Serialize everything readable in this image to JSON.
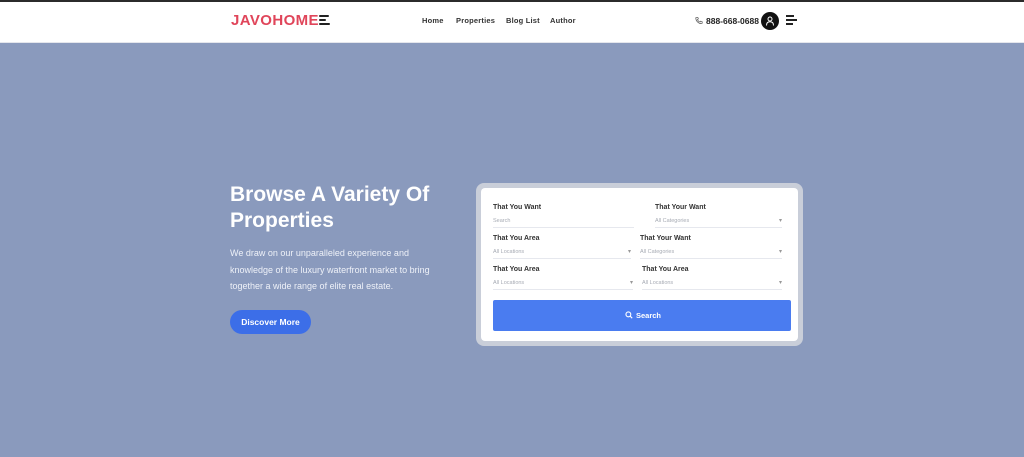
{
  "header": {
    "logo": "JAVOHOME",
    "nav": [
      "Home",
      "Properties",
      "Blog List",
      "Author"
    ],
    "phone": "888-668-0688"
  },
  "hero": {
    "title": "Browse A Variety Of Properties",
    "description": "We draw on our unparalleled experience and knowledge of the luxury waterfront market to bring together a wide range of elite real estate.",
    "cta": "Discover More"
  },
  "search_form": {
    "fields": [
      {
        "label": "That You Want",
        "value": "Search",
        "caret": false
      },
      {
        "label": "That Your Want",
        "value": "All Categories",
        "caret": true
      },
      {
        "label": "That You Area",
        "value": "All Locations",
        "caret": true
      },
      {
        "label": "That Your Want",
        "value": "All Categories",
        "caret": true
      },
      {
        "label": "That You Area",
        "value": "All Locations",
        "caret": true
      },
      {
        "label": "That You Area",
        "value": "All Locations",
        "caret": true
      }
    ],
    "button": "Search"
  },
  "icons": {
    "menu": "hamburger-icon",
    "phone": "phone-icon",
    "avatar": "user-icon",
    "side_menu": "menu-lines-icon",
    "search": "search-icon"
  },
  "colors": {
    "brand": "#e0455a",
    "hero_bg": "#8a9abd",
    "primary": "#3c6ee8",
    "search_button": "#4a7cf0"
  }
}
